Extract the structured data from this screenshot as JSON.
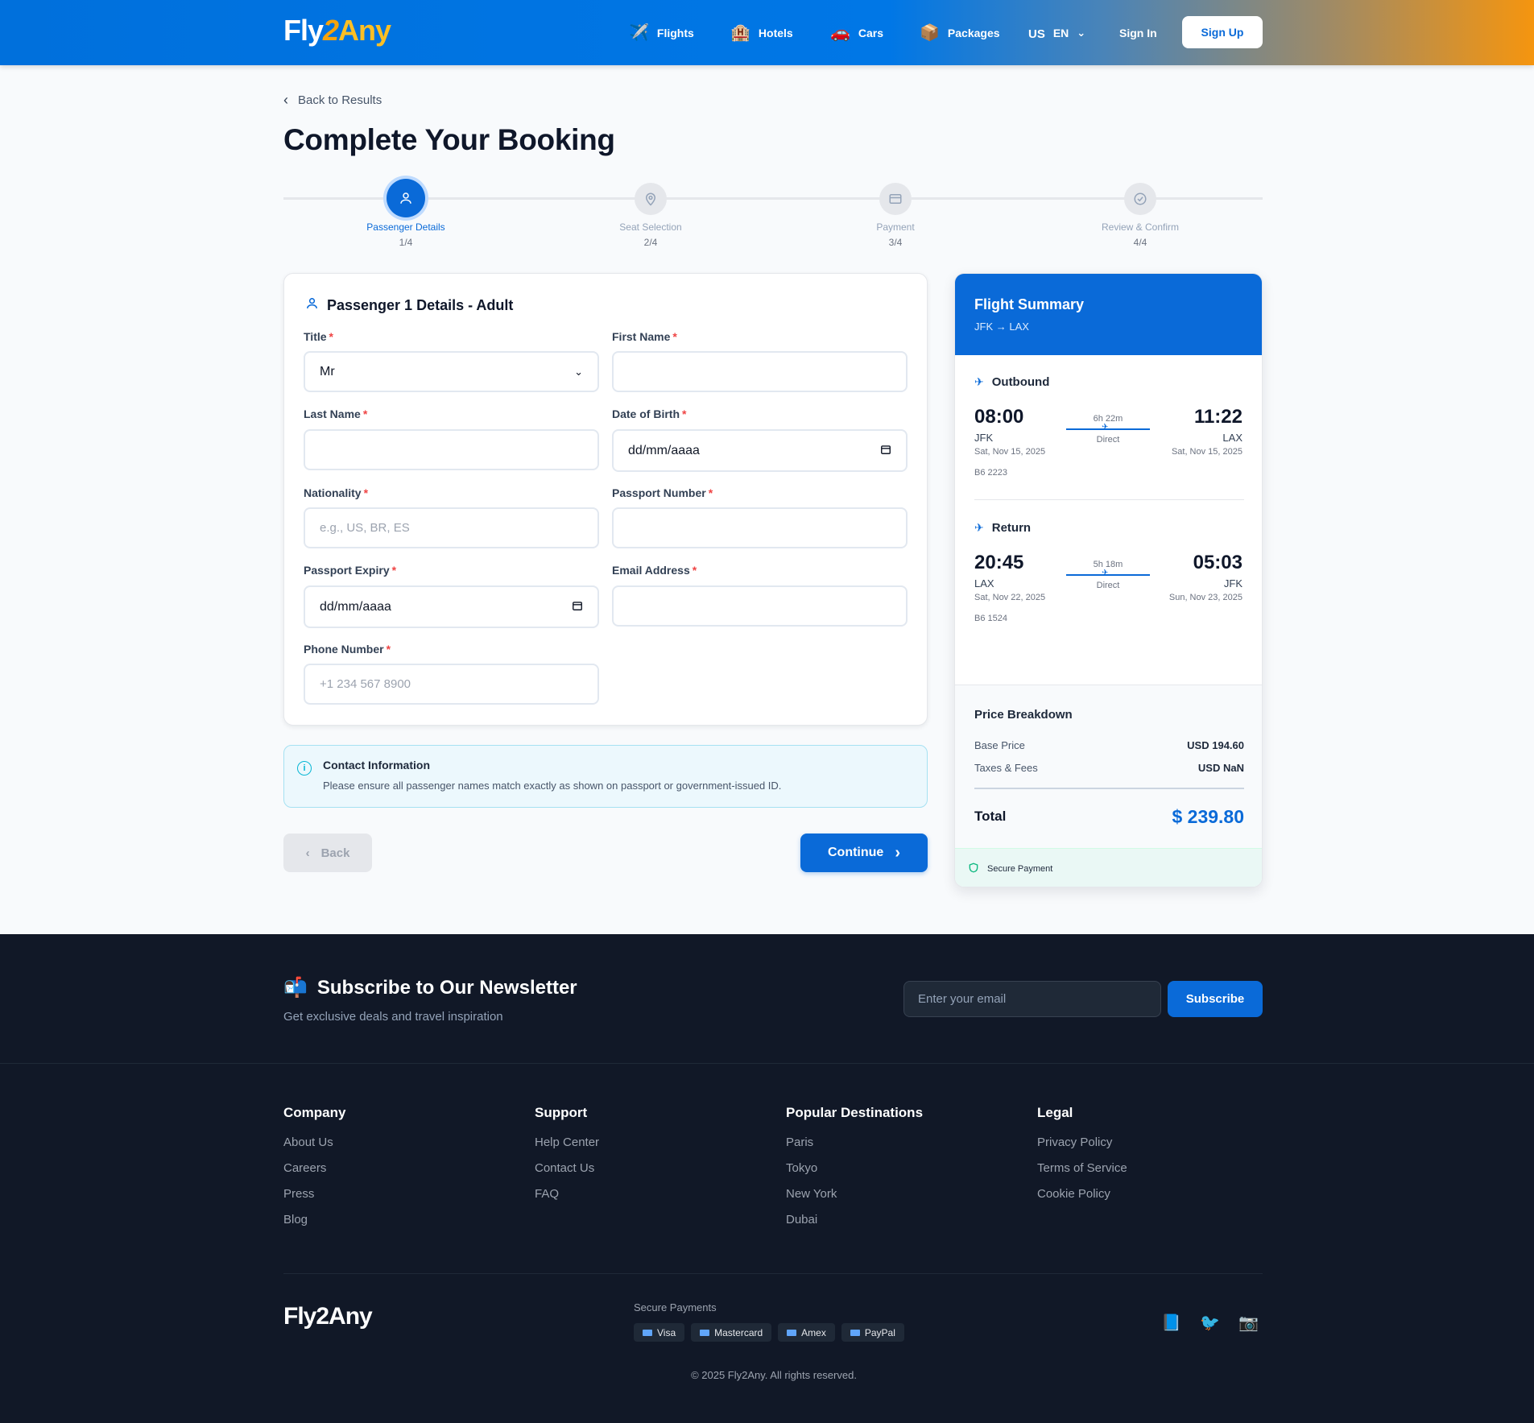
{
  "header": {
    "logo": {
      "part1": "Fly",
      "part2": "2",
      "part3": "Any"
    },
    "nav": [
      {
        "label": "Flights",
        "icon": "✈️"
      },
      {
        "label": "Hotels",
        "icon": "🏨"
      },
      {
        "label": "Cars",
        "icon": "🚗"
      },
      {
        "label": "Packages",
        "icon": "📦"
      }
    ],
    "language": {
      "flag": "US",
      "code": "EN"
    },
    "signin_label": "Sign In",
    "signup_label": "Sign Up"
  },
  "page": {
    "back_label": "Back to Results",
    "title": "Complete Your Booking"
  },
  "stepper": [
    {
      "label": "Passenger Details",
      "progress": "1/4",
      "icon": "user-icon",
      "active": true
    },
    {
      "label": "Seat Selection",
      "progress": "2/4",
      "icon": "map-pin-icon",
      "active": false
    },
    {
      "label": "Payment",
      "progress": "3/4",
      "icon": "credit-card-icon",
      "active": false
    },
    {
      "label": "Review & Confirm",
      "progress": "4/4",
      "icon": "check-circle-icon",
      "active": false
    }
  ],
  "form": {
    "title": "Passenger 1 Details - Adult",
    "required_mark": "*",
    "fields": {
      "title": {
        "label": "Title",
        "value": "Mr"
      },
      "first_name": {
        "label": "First Name",
        "value": ""
      },
      "last_name": {
        "label": "Last Name",
        "value": ""
      },
      "dob": {
        "label": "Date of Birth",
        "value": "dd/mm/aaaa"
      },
      "nationality": {
        "label": "Nationality",
        "placeholder": "e.g., US, BR, ES"
      },
      "passport_number": {
        "label": "Passport Number",
        "value": ""
      },
      "passport_expiry": {
        "label": "Passport Expiry",
        "value": "dd/mm/aaaa"
      },
      "email": {
        "label": "Email Address",
        "value": ""
      },
      "phone": {
        "label": "Phone Number",
        "placeholder": "+1 234 567 8900"
      }
    }
  },
  "info": {
    "title": "Contact Information",
    "text": "Please ensure all passenger names match exactly as shown on passport or government-issued ID."
  },
  "buttons": {
    "back_label": "Back",
    "continue_label": "Continue"
  },
  "summary": {
    "title": "Flight Summary",
    "route": "JFK → LAX",
    "outbound": {
      "label": "Outbound",
      "dep_time": "08:00",
      "dep_code": "JFK",
      "dep_date": "Sat, Nov 15, 2025",
      "arr_time": "11:22",
      "arr_code": "LAX",
      "arr_date": "Sat, Nov 15, 2025",
      "duration": "6h 22m",
      "stops": "Direct",
      "flight_no": "B6 2223"
    },
    "return": {
      "label": "Return",
      "dep_time": "20:45",
      "dep_code": "LAX",
      "dep_date": "Sat, Nov 22, 2025",
      "arr_time": "05:03",
      "arr_code": "JFK",
      "arr_date": "Sun, Nov 23, 2025",
      "duration": "5h 18m",
      "stops": "Direct",
      "flight_no": "B6 1524"
    },
    "price": {
      "title": "Price Breakdown",
      "base_label": "Base Price",
      "base_value": "USD 194.60",
      "taxes_label": "Taxes & Fees",
      "taxes_value": "USD NaN",
      "total_label": "Total",
      "total_value": "$ 239.80"
    },
    "secure_label": "Secure Payment"
  },
  "footer": {
    "newsletter": {
      "title": "Subscribe to Our Newsletter",
      "subtitle": "Get exclusive deals and travel inspiration",
      "placeholder": "Enter your email",
      "button": "Subscribe"
    },
    "columns": [
      {
        "title": "Company",
        "links": [
          "About Us",
          "Careers",
          "Press",
          "Blog"
        ]
      },
      {
        "title": "Support",
        "links": [
          "Help Center",
          "Contact Us",
          "FAQ"
        ]
      },
      {
        "title": "Popular Destinations",
        "links": [
          "Paris",
          "Tokyo",
          "New York",
          "Dubai"
        ]
      },
      {
        "title": "Legal",
        "links": [
          "Privacy Policy",
          "Terms of Service",
          "Cookie Policy"
        ]
      }
    ],
    "logo": "Fly2Any",
    "secure_payments_label": "Secure Payments",
    "payment_methods": [
      "Visa",
      "Mastercard",
      "Amex",
      "PayPal"
    ],
    "copyright": "© 2025 Fly2Any. All rights reserved."
  },
  "colors": {
    "primary": "#0a6ad8",
    "accent_orange": "#f5950f",
    "footer_bg": "#111827",
    "required": "#ef4444"
  }
}
